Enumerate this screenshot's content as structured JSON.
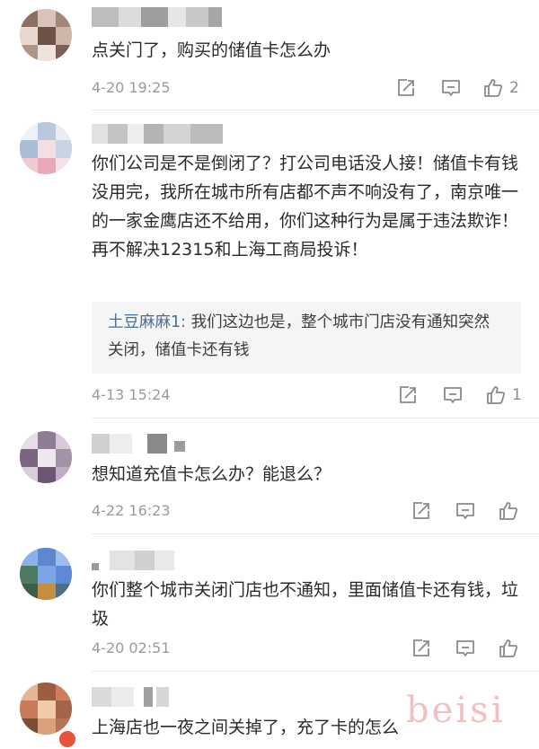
{
  "comments": [
    {
      "text": "点关门了，购买的储值卡怎么办",
      "time": "4-20 19:25",
      "likes": "2"
    },
    {
      "text": "你们公司是不是倒闭了？打公司电话没人接！储值卡有钱没用完，我所在城市所有店都不声不响没有了，南京唯一的一家金鹰店还不给用，你们这种行为是属于违法欺诈！再不解决12315和上海工商局投诉！",
      "reply_name": "土豆麻麻1:",
      "reply_text": " 我们这边也是，整个城市门店没有通知突然关闭，储值卡还有钱",
      "time": "4-13 15:24",
      "likes": "1"
    },
    {
      "text": "想知道充值卡怎么办？能退么？",
      "time": "4-22 16:23"
    },
    {
      "text": "你们整个城市关闭门店也不通知，里面储值卡还有钱，垃圾",
      "time": "4-20 02:51"
    },
    {
      "text": "上海店也一夜之间关掉了，充了卡的怎么"
    }
  ],
  "icons": {
    "share": "share-icon",
    "comment": "comment-icon",
    "like": "thumbs-up-icon"
  },
  "colors": {
    "reply_name": "#4a6f96",
    "meta_gray": "#9a9a9a",
    "watermark": "#f2b6b6"
  },
  "watermark": "beisi"
}
